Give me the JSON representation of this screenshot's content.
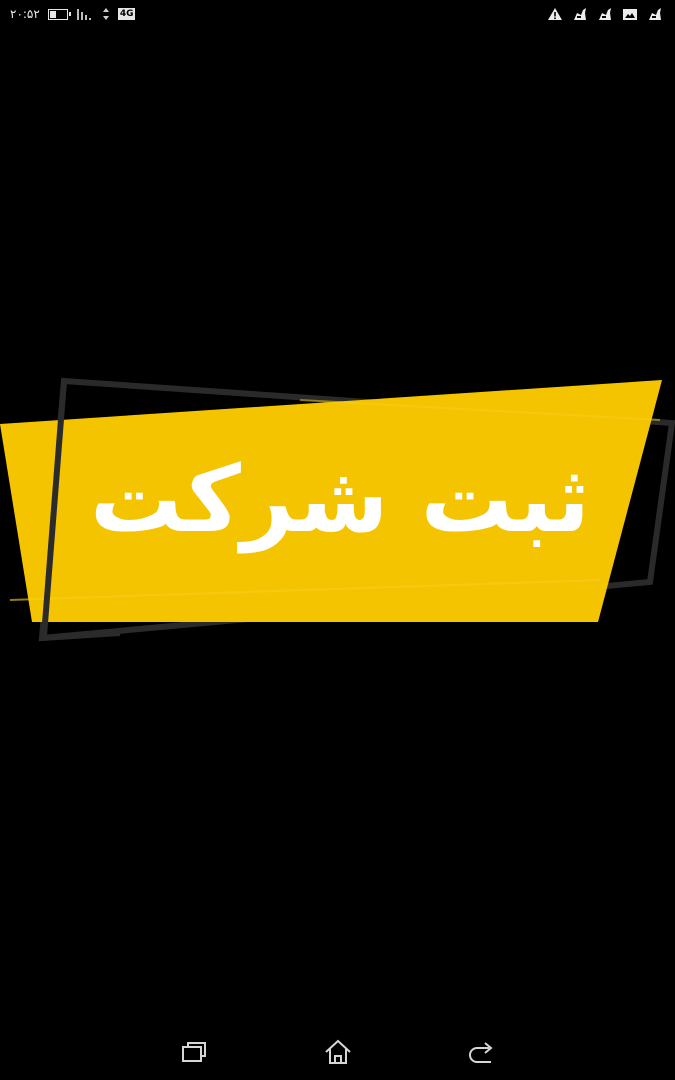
{
  "status_bar": {
    "time": "۲۰:۵۲",
    "network_label": "4G",
    "battery_level": 0.35,
    "left_icons": [
      "battery-icon",
      "signal-icon",
      "data-arrows-icon",
      "network-4g-icon"
    ],
    "right_icons": [
      "warning-icon",
      "notification-icon",
      "notification-icon",
      "image-notification-icon",
      "notification-icon"
    ]
  },
  "banner": {
    "title": "ثبت شرکت",
    "colors": {
      "fill": "#f5c400",
      "frame": "#2a2a2a",
      "text": "#ffffff"
    }
  },
  "nav_bar": {
    "buttons": [
      "recent-apps-icon",
      "home-icon",
      "back-icon"
    ]
  },
  "background": "#000000"
}
